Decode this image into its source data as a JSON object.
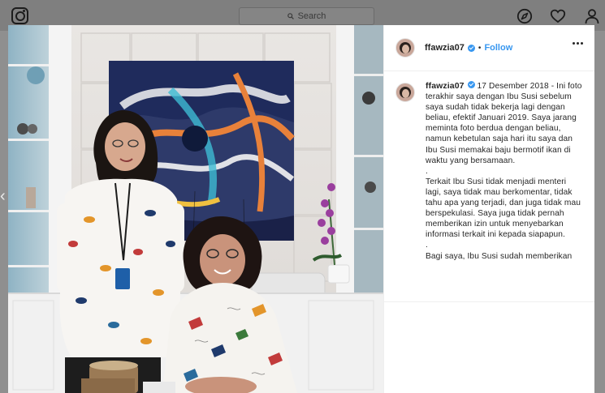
{
  "topbar": {
    "search_placeholder": "Search",
    "icons": [
      "instagram-logo-icon",
      "search-icon",
      "explore-compass-icon",
      "heart-icon",
      "profile-icon"
    ]
  },
  "post": {
    "username": "ffawzia07",
    "follow_label": "Follow",
    "separator": "•",
    "caption_username": "ffawzia07",
    "date": "17 Desember 2018",
    "caption_lines": [
      "- Ini foto terakhir saya dengan Ibu Susi sebelum saya sudah tidak bekerja lagi dengan beliau, efektif Januari 2019. Saya jarang meminta foto berdua dengan beliau, namun kebetulan saja hari itu saya dan Ibu Susi memakai baju bermotif ikan di waktu yang bersamaan.",
      ".",
      "Terkait Ibu Susi tidak menjadi menteri lagi, saya tidak mau berkomentar, tidak tahu apa yang terjadi, dan juga tidak mau berspekulasi. Saya juga tidak pernah memberikan izin untuk menyebarkan informasi terkait ini kepada siapapun.",
      ".",
      "Bagi saya, Ibu Susi sudah memberikan"
    ]
  },
  "colors": {
    "accent": "#3897f0",
    "text": "#262626",
    "overlay": "#8f8f8f"
  }
}
